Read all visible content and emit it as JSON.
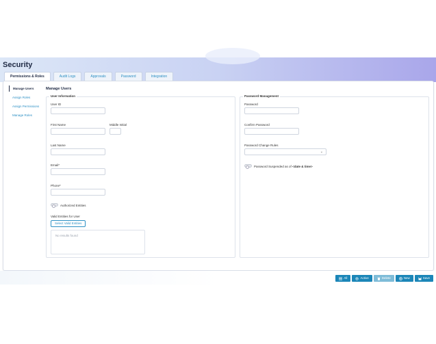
{
  "page": {
    "title": "Security"
  },
  "tabs": [
    {
      "label": "Permissions & Roles",
      "active": true
    },
    {
      "label": "Audit Logs"
    },
    {
      "label": "Approvals"
    },
    {
      "label": "Password"
    },
    {
      "label": "Integration"
    }
  ],
  "sidebar": {
    "items": [
      {
        "label": "Manage Users",
        "active": true
      },
      {
        "label": "Assign Roles"
      },
      {
        "label": "Assign Permissions"
      },
      {
        "label": "Manage Roles"
      }
    ]
  },
  "main": {
    "section_title": "Manage Users",
    "user_info": {
      "legend": "User Information",
      "user_id_label": "User ID",
      "first_name_label": "First Name",
      "middle_initial_label": "Middle Initial",
      "last_name_label": "Last Name",
      "email_label": "Email*",
      "phone_label": "Phone*",
      "authorized_entities_label": "Authorized Entities",
      "valid_entities_label": "Valid Entities for User",
      "select_entities_button": "Select Valid Entities",
      "no_results": "No results found"
    },
    "password_mgmt": {
      "legend": "Password Management",
      "password_label": "Password",
      "confirm_password_label": "Confirm Password",
      "password_change_rules_label": "Password Change Rules",
      "suspended_label": "Password Suspended as of",
      "suspended_value": "<date & time>"
    }
  },
  "actions": [
    {
      "label": "All",
      "icon": "list-icon"
    },
    {
      "label": "Active",
      "icon": "gear-icon"
    },
    {
      "label": "Delete",
      "icon": "trash-icon",
      "disabled": true
    },
    {
      "label": "New",
      "icon": "plus-circle-icon"
    },
    {
      "label": "Save",
      "icon": "save-icon"
    }
  ]
}
